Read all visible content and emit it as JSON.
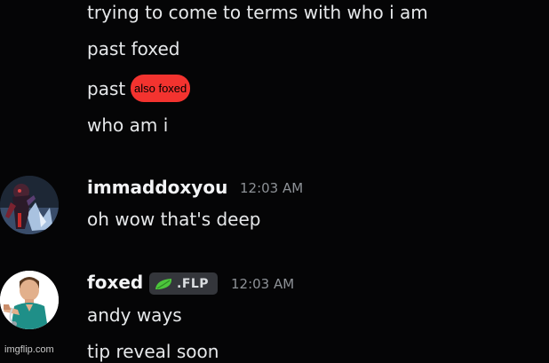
{
  "prior_messages": [
    "trying to come to terms with who i am",
    "past foxed",
    "past",
    "who am i"
  ],
  "highlight_label": "also foxed",
  "highlight_color": "#f3332f",
  "messages": [
    {
      "username": "immaddoxyou",
      "timestamp": "12:03 AM",
      "lines": [
        "oh wow that's deep"
      ],
      "avatar_icon": "dark-fantasy-character-avatar"
    },
    {
      "username": "foxed",
      "timestamp": "12:03 AM",
      "tag": {
        "text": ".FLP",
        "icon": "leaf-icon"
      },
      "lines": [
        "andy ways",
        "tip reveal soon"
      ],
      "avatar_icon": "man-in-teal-scrubs-avatar"
    }
  ],
  "watermark": "imgflip.com"
}
